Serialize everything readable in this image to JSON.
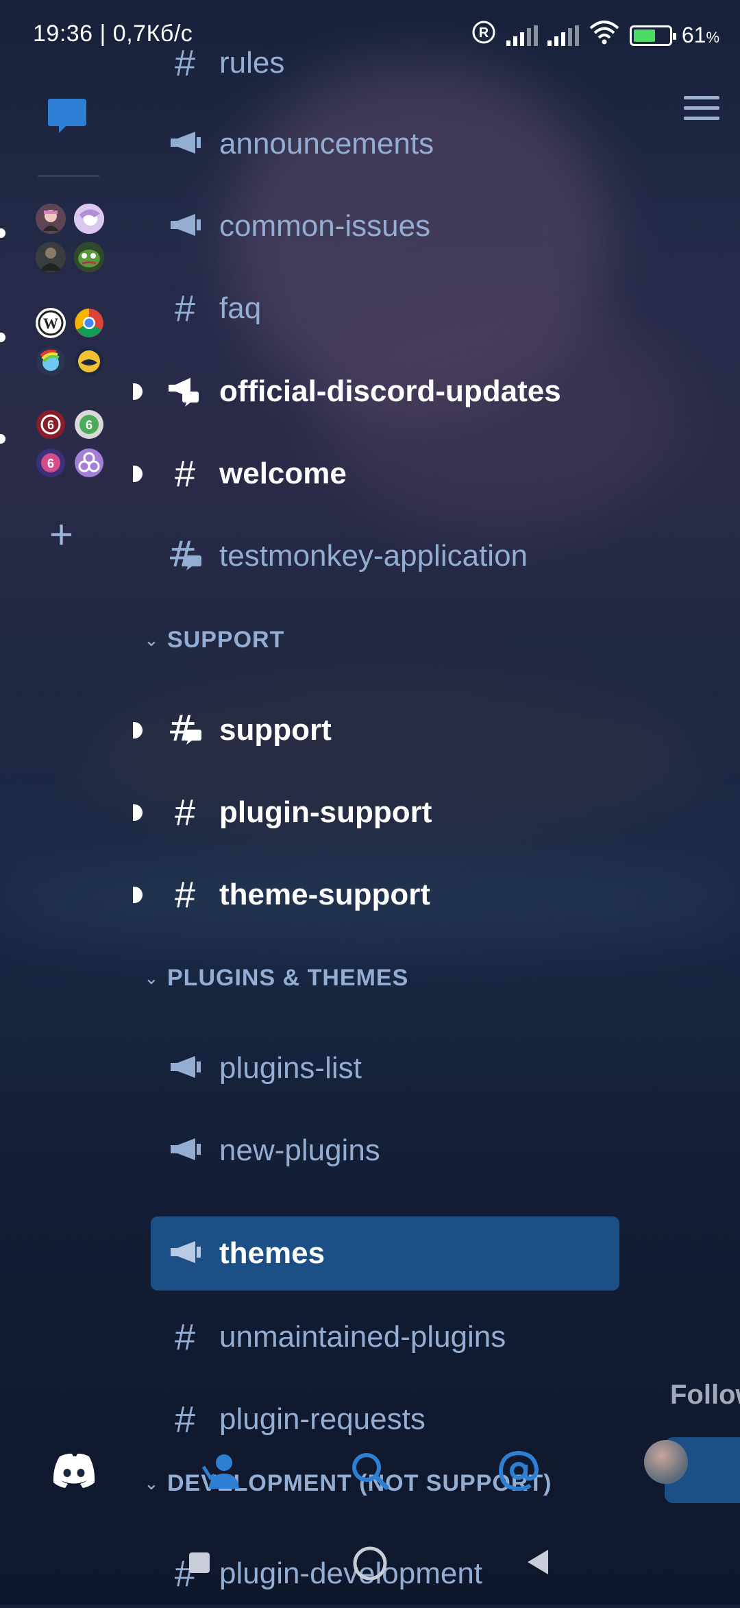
{
  "status_bar": {
    "time": "19:36 | 0,7Кб/с",
    "battery": "61",
    "battery_unit": "%"
  },
  "rail": {
    "folders": [
      {
        "servers": [
          "girl-avatar",
          "anime-avatar",
          "soldier-avatar",
          "pepe-avatar"
        ]
      },
      {
        "servers": [
          "wordpress",
          "chrome",
          "rainbow-dash",
          "python-like"
        ]
      },
      {
        "servers": [
          "rainbow-six-red",
          "rainbow-six-green",
          "rainbow-six-purple",
          "circles-purple"
        ]
      }
    ]
  },
  "channels": {
    "items": [
      {
        "name": "rules",
        "icon": "hash-icon",
        "unread": false
      },
      {
        "name": "announcements",
        "icon": "announcement-icon",
        "unread": false
      },
      {
        "name": "common-issues",
        "icon": "announcement-icon",
        "unread": false
      },
      {
        "name": "faq",
        "icon": "hash-icon",
        "unread": false
      },
      {
        "name": "official-discord-updates",
        "icon": "announcement-thread-icon",
        "unread": true
      },
      {
        "name": "welcome",
        "icon": "hash-icon",
        "unread": true
      },
      {
        "name": "testmonkey-application",
        "icon": "hash-thread-icon",
        "unread": false
      }
    ],
    "categories": {
      "support": {
        "label": "SUPPORT",
        "items": [
          {
            "name": "support",
            "icon": "hash-thread-icon",
            "unread": true
          },
          {
            "name": "plugin-support",
            "icon": "hash-icon",
            "unread": true
          },
          {
            "name": "theme-support",
            "icon": "hash-icon",
            "unread": true
          }
        ]
      },
      "plugins": {
        "label": "PLUGINS & THEMES",
        "items": [
          {
            "name": "plugins-list",
            "icon": "announcement-icon"
          },
          {
            "name": "new-plugins",
            "icon": "announcement-icon"
          },
          {
            "name": "themes",
            "icon": "announcement-icon",
            "selected": true
          },
          {
            "name": "unmaintained-plugins",
            "icon": "hash-icon"
          },
          {
            "name": "plugin-requests",
            "icon": "hash-icon"
          }
        ]
      },
      "development": {
        "label": "DEVELOPMENT (NOT SUPPORT)",
        "items": [
          {
            "name": "plugin-development",
            "icon": "hash-icon"
          }
        ]
      }
    }
  },
  "right_panel": {
    "follow_text": "Follow"
  },
  "colors": {
    "accent": "#1c4f86",
    "channel_text": "#93aed2",
    "unread_text": "#ffffff",
    "dm_blue": "#2d7fd3"
  }
}
